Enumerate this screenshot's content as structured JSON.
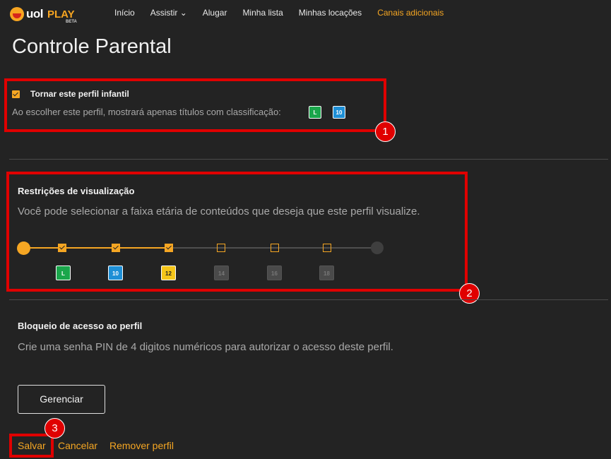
{
  "header": {
    "logo": {
      "uol": "uol",
      "play": "PLAY",
      "beta": "BETA"
    },
    "nav": [
      {
        "label": "Início"
      },
      {
        "label": "Assistir ⌄"
      },
      {
        "label": "Alugar"
      },
      {
        "label": "Minha lista"
      },
      {
        "label": "Minhas locações"
      },
      {
        "label": "Canais adicionais"
      }
    ]
  },
  "page": {
    "title": "Controle Parental"
  },
  "kids_profile": {
    "checkbox_label": "Tornar este perfil infantil",
    "description": "Ao escolher este perfil, mostrará apenas títulos com classificação:",
    "ratings": [
      {
        "label": "L",
        "color": "#1aa64b"
      },
      {
        "label": "10",
        "color": "#1e8fd6"
      }
    ]
  },
  "restrictions": {
    "title": "Restrições de visualização",
    "description": "Você pode selecionar a faixa etária de conteúdos que deseja que este perfil visualize.",
    "ratings": [
      {
        "label": "L",
        "color": "#1aa64b",
        "selected": true
      },
      {
        "label": "10",
        "color": "#1e8fd6",
        "selected": true
      },
      {
        "label": "12",
        "color": "#f5c518",
        "selected": true
      },
      {
        "label": "14",
        "color": "#4a4a4a",
        "selected": false
      },
      {
        "label": "16",
        "color": "#4a4a4a",
        "selected": false
      },
      {
        "label": "18",
        "color": "#4a4a4a",
        "selected": false
      }
    ],
    "accent_color": "#f5a623"
  },
  "profile_lock": {
    "title": "Bloqueio de acesso ao perfil",
    "description": "Crie uma senha PIN de 4 digitos numéricos para autorizar o acesso deste perfil.",
    "manage_button": "Gerenciar"
  },
  "actions": {
    "save": "Salvar",
    "cancel": "Cancelar",
    "remove": "Remover perfil"
  },
  "annotations": [
    "1",
    "2",
    "3"
  ]
}
